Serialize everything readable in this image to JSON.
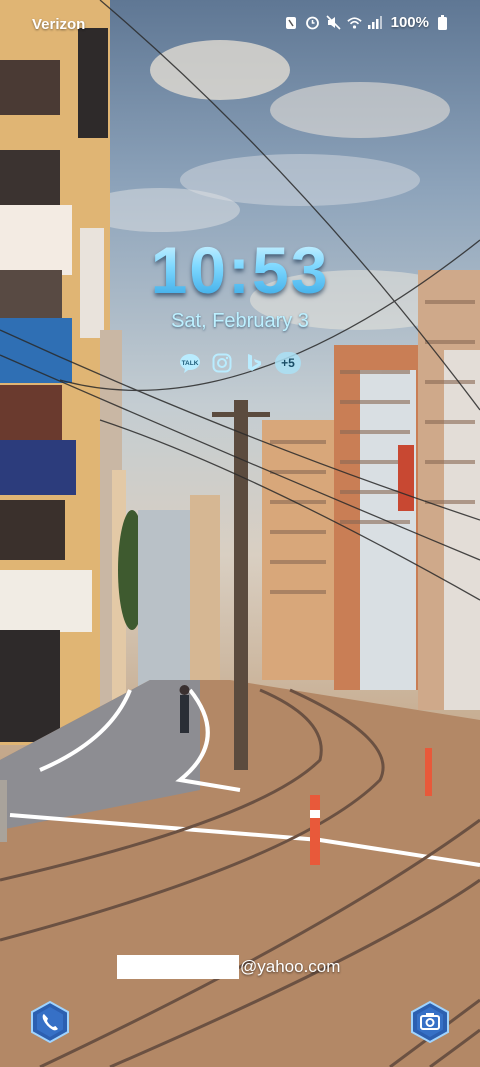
{
  "status_bar": {
    "carrier": "Verizon",
    "battery": "100%",
    "icons": [
      "nfc-icon",
      "alarm-icon",
      "mute-icon",
      "wifi-icon",
      "signal-icon",
      "battery-icon"
    ]
  },
  "lockscreen": {
    "time": "10:53",
    "date": "Sat, February 3",
    "notifications": [
      "talk-icon",
      "instagram-icon",
      "bing-icon"
    ],
    "more_count": "+5",
    "owner_email_suffix": "@yahoo.com"
  },
  "shortcuts": {
    "left": "phone-icon",
    "right": "camera-icon"
  },
  "colors": {
    "clock_accent": "#7fd8ff",
    "shortcut_hex": "#2c5fb0"
  }
}
